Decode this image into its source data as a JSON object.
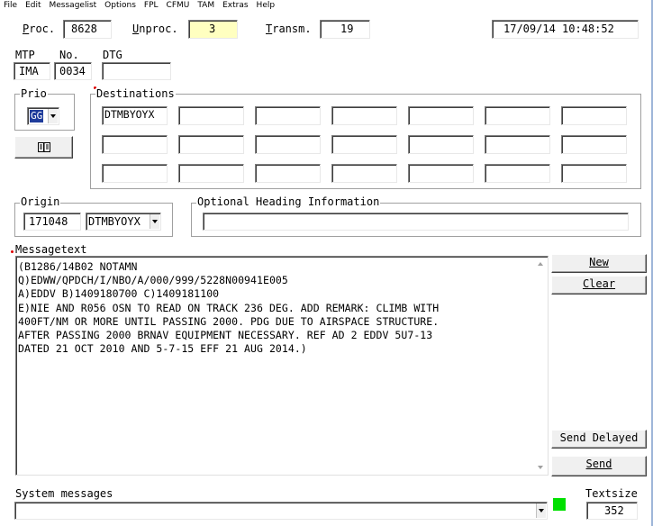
{
  "menu": [
    "File",
    "Edit",
    "Messagelist",
    "Options",
    "FPL",
    "CFMU",
    "TAM",
    "Extras",
    "Help"
  ],
  "status": {
    "proc_label": "Proc.",
    "proc_value": "8628",
    "unproc_label": "Unproc.",
    "unproc_value": "3",
    "transm_label": "Transm.",
    "transm_value": "19",
    "datetime": "17/09/14 10:48:52"
  },
  "header_fields": {
    "mtp_label": "MTP",
    "mtp_value": "IMA",
    "no_label": "No.",
    "no_value": "0034",
    "dtg_label": "DTG",
    "dtg_value": ""
  },
  "prio": {
    "label": "Prio",
    "value": "GG"
  },
  "destinations": {
    "label": "Destinations",
    "values": [
      "DTMBYOYX",
      "",
      "",
      "",
      "",
      "",
      "",
      "",
      "",
      "",
      "",
      "",
      "",
      "",
      "",
      "",
      "",
      "",
      "",
      "",
      ""
    ]
  },
  "origin": {
    "label": "Origin",
    "time": "171048",
    "address": "DTMBYOYX"
  },
  "optional_heading": {
    "label": "Optional Heading Information",
    "value": ""
  },
  "messagetext": {
    "label": "Messagetext",
    "lines": [
      "(B1286/14B02 NOTAMN",
      "Q)EDWW/QPDCH/I/NBO/A/000/999/5228N00941E005",
      "A)EDDV B)1409180700 C)1409181100",
      "E)NIE AND R056 OSN TO READ ON TRACK 236 DEG. ADD REMARK: CLIMB WITH",
      "400FT/NM OR MORE UNTIL PASSING 2000. PDG DUE TO AIRSPACE STRUCTURE.",
      "AFTER PASSING 2000 BRNAV EQUIPMENT NECESSARY. REF AD 2 EDDV 5U7-13",
      "DATED 21 OCT 2010 AND 5-7-15 EFF 21 AUG 2014.)"
    ]
  },
  "buttons": {
    "new": "New",
    "clear": "Clear",
    "send_delayed": "Send Delayed",
    "send": "Send"
  },
  "system_messages": {
    "label": "System messages",
    "value": ""
  },
  "textsize": {
    "label": "Textsize",
    "value": "352"
  },
  "colors": {
    "unproc_bg": "#ffffc0",
    "status_led": "#00e000",
    "required_marker": "#e00000"
  },
  "icons": {
    "address_book": "address-book-icon"
  }
}
